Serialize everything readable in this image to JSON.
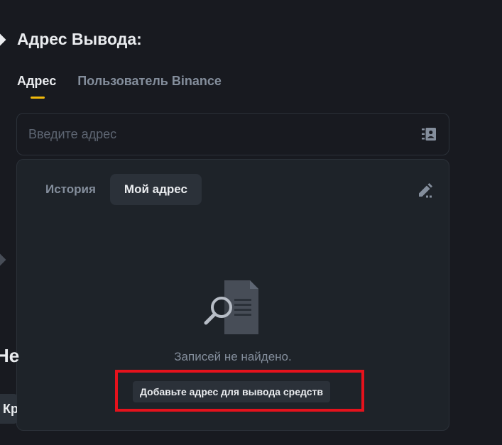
{
  "form": {
    "section_title": "Адрес Вывода:",
    "tabs": [
      {
        "label": "Адрес",
        "active": true
      },
      {
        "label": "Пользователь Binance",
        "active": false
      }
    ],
    "address_input": {
      "value": "",
      "placeholder": "Введите адрес"
    },
    "cut_off_heading": "Не",
    "cut_off_chip": "Кр"
  },
  "address_dropdown": {
    "sub_tabs": [
      {
        "label": "История",
        "active": false
      },
      {
        "label": "Мой адрес",
        "active": true
      }
    ],
    "empty_message": "Записей не найдено.",
    "add_button_label": "Добавьте адрес для вывода средств"
  },
  "icons": {
    "address_book": "address-book-icon",
    "edit": "edit-icon",
    "empty_state": "document-search-icon"
  },
  "colors": {
    "background": "#181a20",
    "panel": "#1e2329",
    "accent": "#f0b90b",
    "highlight": "#e5121c",
    "muted_text": "#848e9c"
  }
}
